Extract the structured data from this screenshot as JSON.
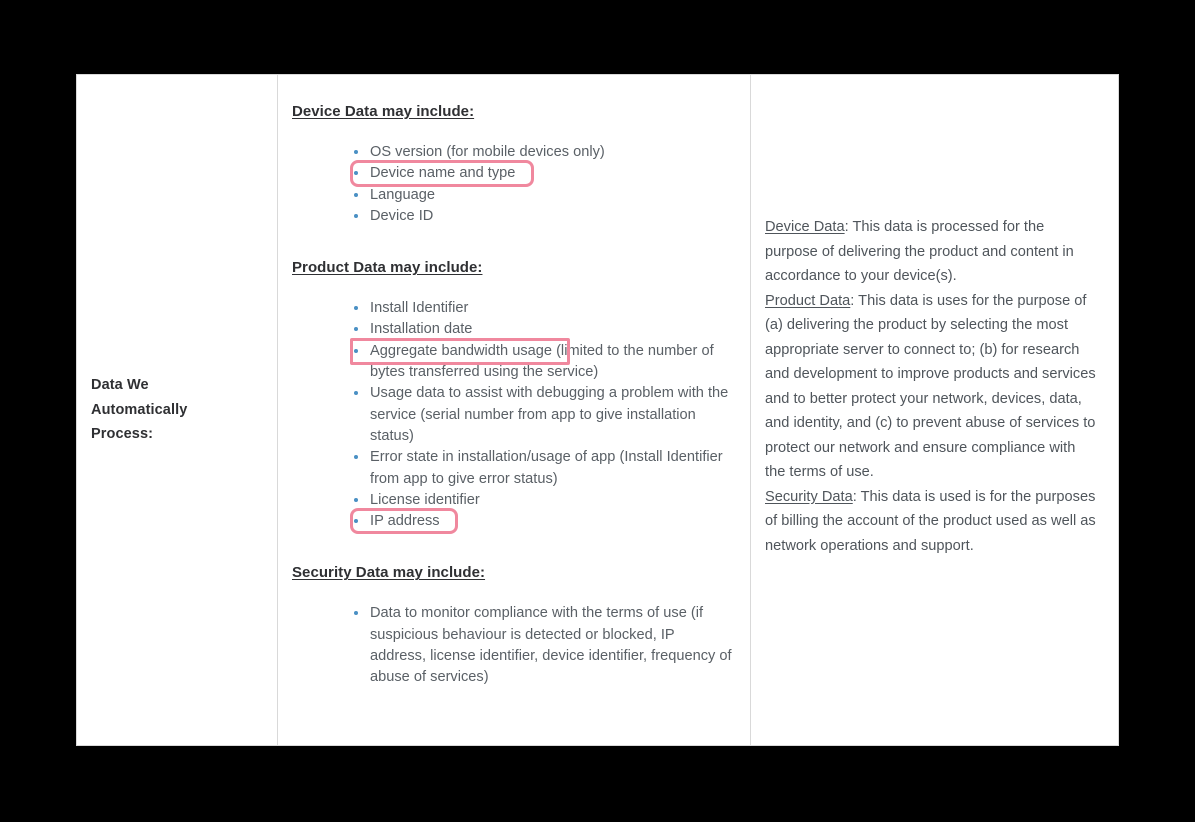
{
  "document": {
    "title": "Privacy Policy — Data We Automatically Process"
  },
  "colors": {
    "highlight": "#f0889e",
    "bullet": "#4a90c4",
    "body_text": "#5a6066",
    "heading_text": "#2f3033",
    "page_background": "#ffffff",
    "canvas_background": "#000000",
    "table_border": "#d9d9d9"
  },
  "row": {
    "label": {
      "line1": "Data We",
      "line2": "Automatically",
      "line3": "Process:"
    },
    "middle_column": {
      "sections": [
        {
          "heading": "Device Data may include:",
          "items": [
            {
              "text": "OS version (for mobile devices only)",
              "highlighted": false
            },
            {
              "text": "Device name and type",
              "highlighted": true,
              "highlight_style": "rounded",
              "highlight_width": 178
            },
            {
              "text": "Language",
              "highlighted": false
            },
            {
              "text": "Device ID",
              "highlighted": false
            }
          ]
        },
        {
          "heading": "Product Data may include:",
          "items": [
            {
              "text": "Install Identifier",
              "highlighted": false
            },
            {
              "text": "Installation date",
              "highlighted": false
            },
            {
              "text": "Aggregate bandwidth usage (limited to the number of bytes transferred using the service)",
              "highlighted": true,
              "highlight_style": "sharp",
              "highlight_width": 214,
              "highlight_phrase": "Aggregate bandwidth usage"
            },
            {
              "text": "Usage data to assist with debugging a problem with the service (serial number from app to give installation status)",
              "highlighted": false
            },
            {
              "text": "Error state in installation/usage of app (Install Identifier from app to give error status)",
              "highlighted": false
            },
            {
              "text": "License identifier",
              "highlighted": false
            },
            {
              "text": "IP address",
              "highlighted": true,
              "highlight_style": "rounded",
              "highlight_width": 102
            }
          ]
        },
        {
          "heading": "Security Data may include:",
          "items": [
            {
              "text": "Data to monitor compliance with the terms of use (if suspicious behaviour is detected or blocked, IP address, license identifier, device identifier, frequency of abuse of services)",
              "highlighted": false
            }
          ]
        }
      ]
    },
    "right_column": {
      "paragraphs": [
        {
          "term": "Device Data",
          "body": ": This data is processed for the purpose of delivering the product and content in accordance to your device(s)."
        },
        {
          "term": "Product Data",
          "body": ": This data is uses for the purpose of (a) delivering the product by selecting the most appropriate server to connect to; (b) for research and development to improve products and services and to better protect your network, devices, data, and identity, and (c) to prevent abuse of services to protect our network and ensure compliance with the terms of use."
        },
        {
          "term": "Security Data",
          "body": ": This data is used is for the purposes of billing the account of the product used as well as network operations and support."
        }
      ]
    }
  }
}
